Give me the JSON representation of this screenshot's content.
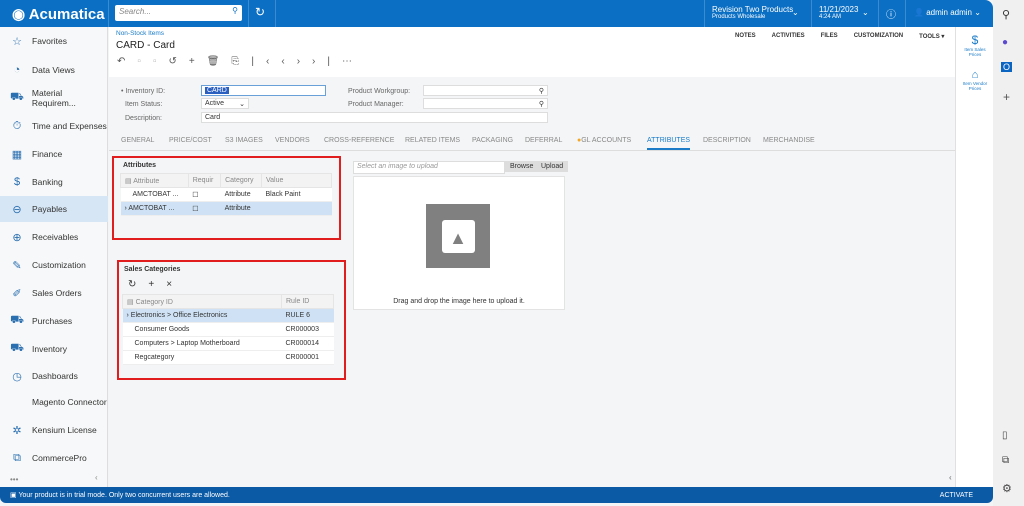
{
  "app": {
    "logo": "Acumatica",
    "search_placeholder": "Search...",
    "company": "Revision Two Products",
    "branch": "Products Wholesale",
    "date": "11/21/2023",
    "time": "4:24 AM",
    "user": "admin admin",
    "brand_color": "#0b6fc4"
  },
  "sidebar": {
    "items": [
      {
        "label": "Favorites",
        "icon": "☆"
      },
      {
        "label": "Data Views",
        "icon": "◔"
      },
      {
        "label": "Material Requirem...",
        "icon": "⛟"
      },
      {
        "label": "Time and Expenses",
        "icon": "⏱"
      },
      {
        "label": "Finance",
        "icon": "▦"
      },
      {
        "label": "Banking",
        "icon": "$"
      },
      {
        "label": "Payables",
        "icon": "⊖"
      },
      {
        "label": "Receivables",
        "icon": "⊕"
      },
      {
        "label": "Customization",
        "icon": "✎"
      },
      {
        "label": "Sales Orders",
        "icon": "✐"
      },
      {
        "label": "Purchases",
        "icon": "⛟"
      },
      {
        "label": "Inventory",
        "icon": "⛟"
      },
      {
        "label": "Dashboards",
        "icon": "◷"
      },
      {
        "label": "Magento Connector",
        "icon": ""
      },
      {
        "label": "Kensium License",
        "icon": "✲"
      },
      {
        "label": "CommercePro",
        "icon": "⧉"
      }
    ],
    "more": "•••",
    "collapse": "‹"
  },
  "page": {
    "breadcrumb": "Non-Stock Items",
    "title": "CARD - Card",
    "actions": [
      "NOTES",
      "ACTIVITIES",
      "FILES",
      "CUSTOMIZATION",
      "TOOLS ▾"
    ],
    "form": {
      "inventory_id_label": "• Inventory ID:",
      "inventory_id": "CARD",
      "item_status_label": "Item Status:",
      "item_status": "Active",
      "description_label": "Description:",
      "description": "Card",
      "workgroup_label": "Product Workgroup:",
      "manager_label": "Product Manager:"
    },
    "tabs": [
      "GENERAL",
      "PRICE/COST",
      "S3 IMAGES",
      "VENDORS",
      "CROSS-REFERENCE",
      "RELATED ITEMS",
      "PACKAGING",
      "DEFERRAL",
      "GL ACCOUNTS",
      "ATTRIBUTES",
      "DESCRIPTION",
      "MERCHANDISE"
    ],
    "active_tab": "ATTRIBUTES",
    "attributes": {
      "title": "Attributes",
      "columns": [
        "Attribute",
        "Requir",
        "Category",
        "Value"
      ],
      "rows": [
        {
          "attribute": "AMCTOBAT ...",
          "category": "Attribute",
          "value": "Black Paint"
        },
        {
          "attribute": "AMCTOBAT ...",
          "category": "Attribute",
          "value": ""
        }
      ]
    },
    "sales_categories": {
      "title": "Sales Categories",
      "columns": [
        "Category ID",
        "Rule ID"
      ],
      "rows": [
        {
          "category": "Electronics > Office Electronics",
          "rule": "RULE 6"
        },
        {
          "category": "Consumer Goods",
          "rule": "CR000003"
        },
        {
          "category": "Computers > Laptop Motherboard",
          "rule": "CR000014"
        },
        {
          "category": "Regcategory",
          "rule": "CR000001"
        }
      ]
    },
    "image": {
      "placeholder": "Select an image to upload",
      "browse": "Browse",
      "upload": "Upload",
      "drop_text": "Drag and drop the image here to upload it."
    }
  },
  "right_panel": {
    "sales_prices": "Item Sales Prices",
    "vendor_prices": "Item Vendor Prices"
  },
  "footer": {
    "message": "Your product is in trial mode. Only two concurrent users are allowed.",
    "activate": "ACTIVATE"
  }
}
